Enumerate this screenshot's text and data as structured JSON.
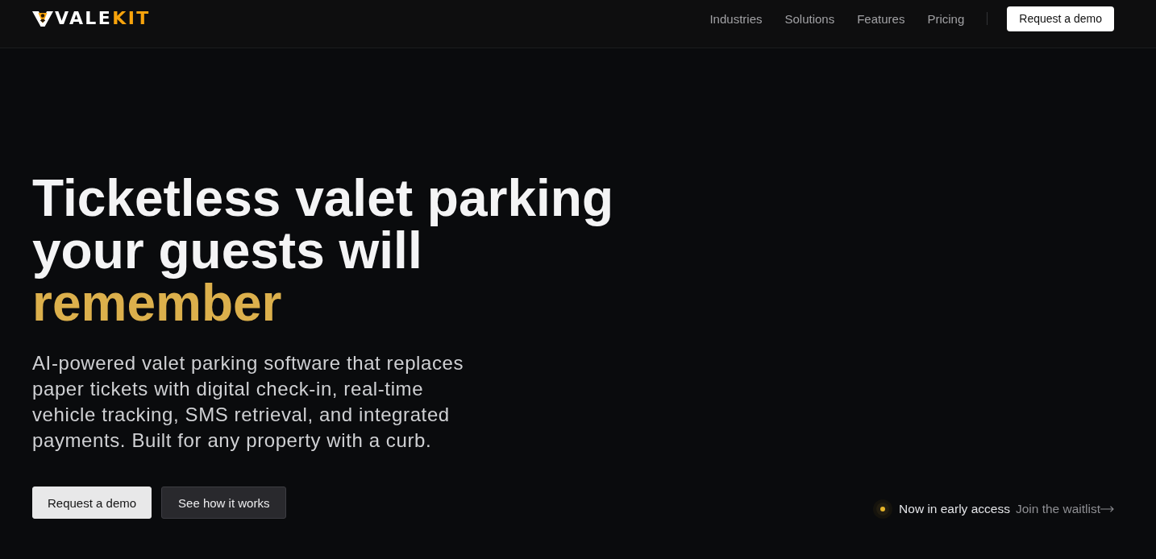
{
  "header": {
    "logo": {
      "parts": [
        {
          "text": "VALE",
          "color": "#ffffff"
        },
        {
          "text": "KIT",
          "color": "#f7a30c"
        }
      ]
    },
    "nav": [
      "Industries",
      "Solutions",
      "Features",
      "Pricing"
    ],
    "cta": "Request a demo"
  },
  "hero": {
    "headline": "Ticketless valet parking your guests will",
    "headline_accent": "remember",
    "subtitle": "AI-powered valet parking software that replaces paper tickets with digital check-in, real-time vehicle tracking, SMS retrieval, and integrated payments. Built for any property with a curb.",
    "buttons": [
      {
        "label": "Request a demo",
        "kind": "primary"
      },
      {
        "label": "See how it works",
        "kind": "secondary"
      }
    ]
  },
  "early_access": {
    "status": "Now in early access",
    "link": "Join the waitlist"
  }
}
